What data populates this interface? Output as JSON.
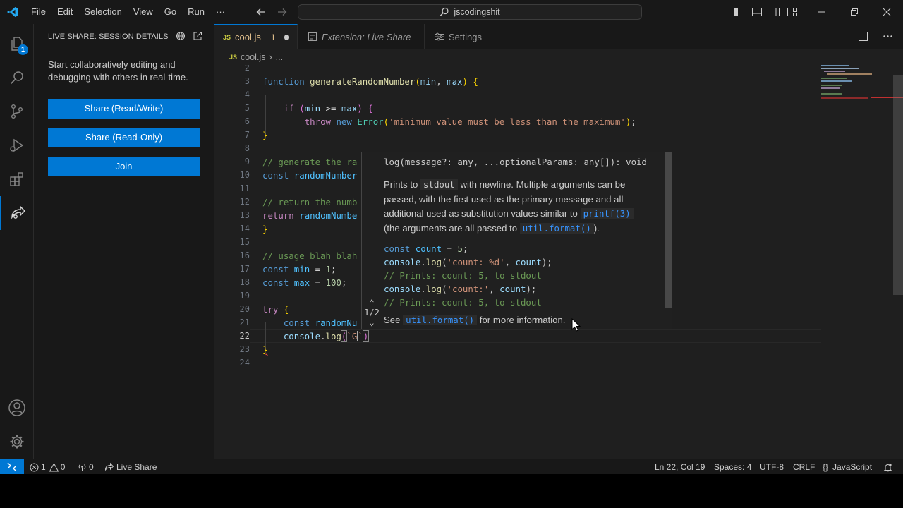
{
  "titlebar": {
    "menu": [
      "File",
      "Edit",
      "Selection",
      "View",
      "Go",
      "Run",
      "···"
    ],
    "search": "jscodingshit"
  },
  "activity": {
    "explorer_badge": "1"
  },
  "sidebar": {
    "title": "LIVE SHARE: SESSION DETAILS",
    "description": "Start collaboratively editing and debugging with others in real-time.",
    "buttons": [
      "Share (Read/Write)",
      "Share (Read-Only)",
      "Join"
    ]
  },
  "tabs": [
    {
      "icon": "JS",
      "label": "cool.js",
      "problems": "1"
    },
    {
      "label": "Extension: Live Share"
    },
    {
      "label": "Settings"
    }
  ],
  "breadcrumb": {
    "icon": "JS",
    "file": "cool.js",
    "rest": "..."
  },
  "editor": {
    "line_numbers": [
      "2",
      "3",
      "4",
      "5",
      "6",
      "7",
      "8",
      "9",
      "10",
      "11",
      "12",
      "13",
      "14",
      "15",
      "16",
      "17",
      "18",
      "19",
      "20",
      "21",
      "22",
      "23",
      "24"
    ],
    "current_line": "22"
  },
  "hover": {
    "signature": "log(message?: any, ...optionalParams: any[]): void",
    "doc_p1": "Prints to ",
    "doc_code1": "stdout",
    "doc_p2": " with newline. Multiple arguments can be passed, with the first used as the primary message and all additional used as substitution values similar to ",
    "doc_code2": "printf(3)",
    "doc_p3": " (the arguments are all passed to ",
    "doc_code3": "util.format()",
    "doc_p4": ").",
    "see_prefix": "See ",
    "see_code": "util.format()",
    "see_suffix": " for more information.",
    "nav": "1/2"
  },
  "status": {
    "errors": "1",
    "warnings": "0",
    "ports": "0",
    "live_share": "Live Share",
    "position": "Ln 22, Col 19",
    "spaces": "Spaces: 4",
    "encoding": "UTF-8",
    "eol": "CRLF",
    "language": "JavaScript"
  },
  "colors": {
    "accent": "#0078d4",
    "editor_bg": "#1f1f1f",
    "chrome_bg": "#181818"
  }
}
